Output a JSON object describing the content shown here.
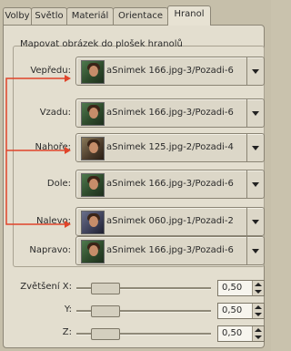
{
  "tabs": [
    "Volby",
    "Světlo",
    "Materiál",
    "Orientace",
    "Hranol"
  ],
  "active_tab": "Hranol",
  "group_title": "Mapovat obrázek do plošek hranolů",
  "faces": [
    {
      "label": "Vepředu:",
      "value": "aSnimek 166.jpg-3/Pozadi-6"
    },
    {
      "label": "Vzadu:",
      "value": "aSnimek 166.jpg-3/Pozadi-6"
    },
    {
      "label": "Nahoře:",
      "value": "aSnimek 125.jpg-2/Pozadi-4"
    },
    {
      "label": "Dole:",
      "value": "aSnimek 166.jpg-3/Pozadi-6"
    },
    {
      "label": "Nalevo:",
      "value": "aSnimek 060.jpg-1/Pozadi-2"
    },
    {
      "label": "Napravo:",
      "value": "aSnimek 166.jpg-3/Pozadi-6"
    }
  ],
  "zoom": [
    {
      "label": "Zvětšení X:",
      "value": "0,50"
    },
    {
      "label": "Y:",
      "value": "0,50"
    },
    {
      "label": "Z:",
      "value": "0,50"
    }
  ],
  "colors": {
    "annotation_line": "#e0442a",
    "panel": "#e3decf"
  },
  "icons": {
    "dropdown": "chevron-down-icon",
    "spin": "spin-arrows-icon",
    "thumbnail": "image-thumbnail-icon"
  }
}
